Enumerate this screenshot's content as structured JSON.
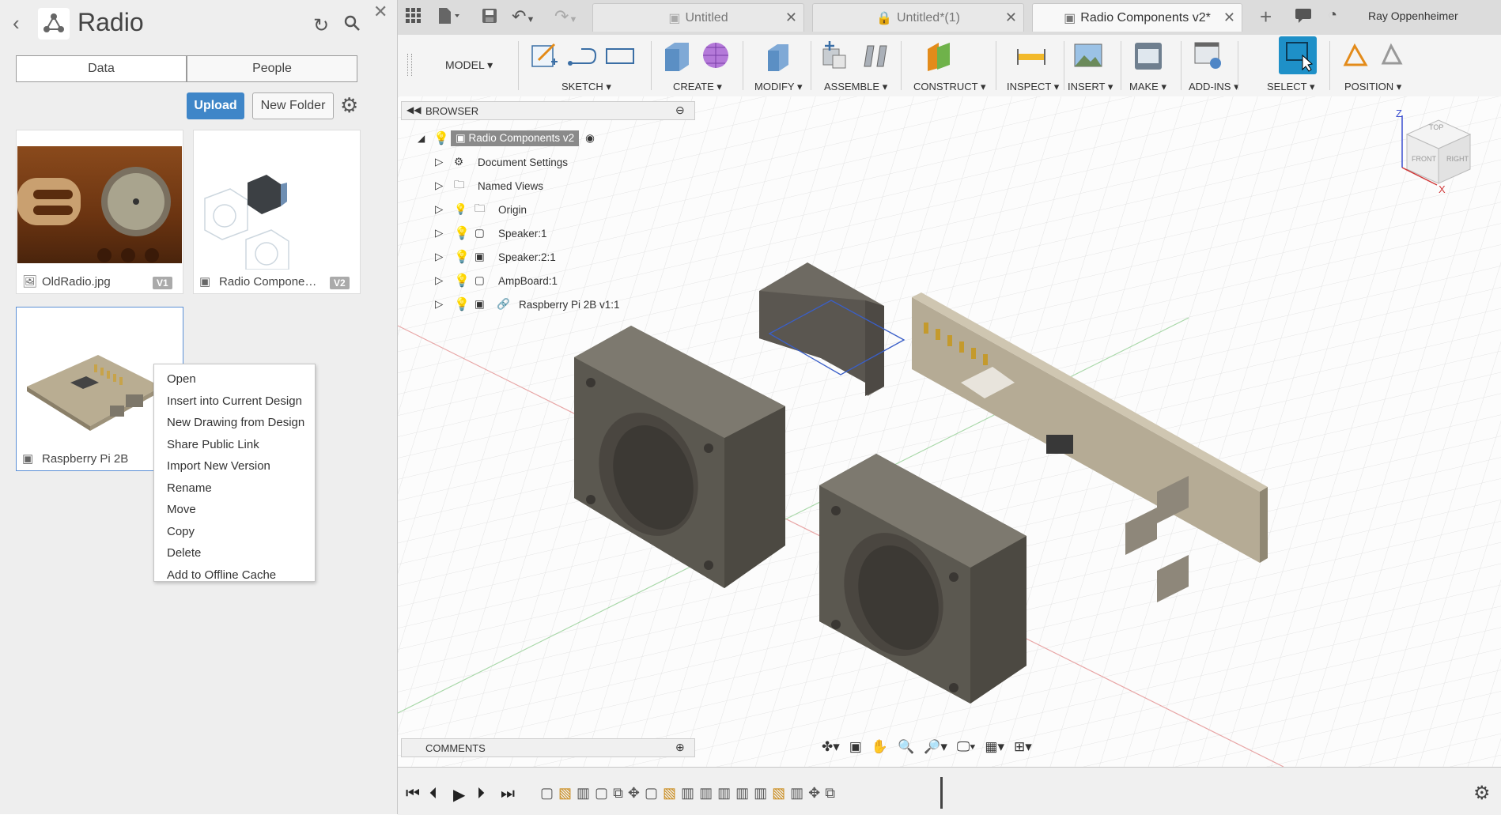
{
  "panel": {
    "back_icon": "chevron-left-icon",
    "project_title": "Radio",
    "tabs": [
      "Data",
      "People"
    ],
    "upload_label": "Upload",
    "new_folder_label": "New Folder",
    "files": [
      {
        "name": "OldRadio.jpg",
        "version": "V1",
        "icon": "image-icon"
      },
      {
        "name": "Radio Compone…",
        "version": "V2",
        "icon": "assembly-icon"
      },
      {
        "name": "Raspberry Pi 2B",
        "version": "",
        "icon": "component-icon"
      }
    ]
  },
  "context_menu": {
    "items": [
      "Open",
      "Insert into Current Design",
      "New Drawing from Design",
      "Share Public Link",
      "Import New Version",
      "Rename",
      "Move",
      "Copy",
      "Delete",
      "Add to Offline Cache"
    ]
  },
  "tabs": [
    {
      "label": "Untitled",
      "locked": false
    },
    {
      "label": "Untitled*(1)",
      "locked": true
    },
    {
      "label": "Radio Components v2*",
      "locked": false
    }
  ],
  "user_name": "Ray Oppenheimer",
  "workspace": "MODEL",
  "toolbar_groups": [
    "SKETCH",
    "CREATE",
    "MODIFY",
    "ASSEMBLE",
    "CONSTRUCT",
    "INSPECT",
    "INSERT",
    "MAKE",
    "ADD-INS",
    "SELECT",
    "POSITION"
  ],
  "browser": {
    "title": "BROWSER",
    "root": "Radio Components v2",
    "items": [
      "Document Settings",
      "Named Views",
      "Origin",
      "Speaker:1",
      "Speaker:2:1",
      "AmpBoard:1",
      "Raspberry Pi 2B v1:1"
    ]
  },
  "comments_title": "COMMENTS",
  "viewcube": {
    "top": "TOP",
    "front": "FRONT",
    "right": "RIGHT",
    "z": "Z",
    "x": "X"
  },
  "colors": {
    "accent": "#3f86c8",
    "select_active": "#1e90c8",
    "bulb": "#e9b614"
  }
}
